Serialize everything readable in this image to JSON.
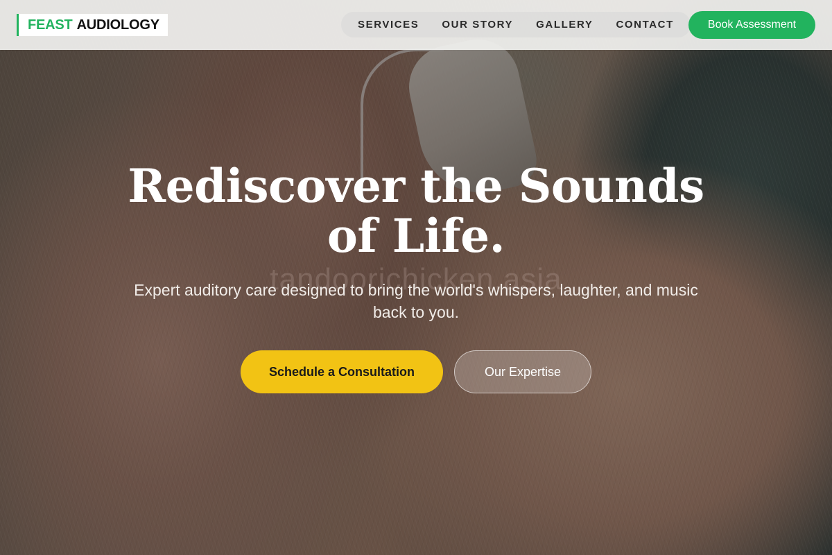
{
  "header": {
    "logo": {
      "accent": "FEAST",
      "main": "AUDIOLOGY"
    },
    "nav": [
      {
        "label": "SERVICES"
      },
      {
        "label": "OUR STORY"
      },
      {
        "label": "GALLERY"
      },
      {
        "label": "CONTACT"
      }
    ],
    "book_button": "Book Assessment"
  },
  "hero": {
    "title": "Rediscover the Sounds of Life.",
    "subtitle": "Expert auditory care designed to bring the world's whispers, laughter, and music back to you.",
    "primary_cta": "Schedule a Consultation",
    "secondary_cta": "Our Expertise",
    "watermark": "tandoorichicken.asia"
  },
  "colors": {
    "brand_green": "#22b35e",
    "cta_yellow": "#f2c314",
    "header_bg": "#f2f2f0"
  }
}
